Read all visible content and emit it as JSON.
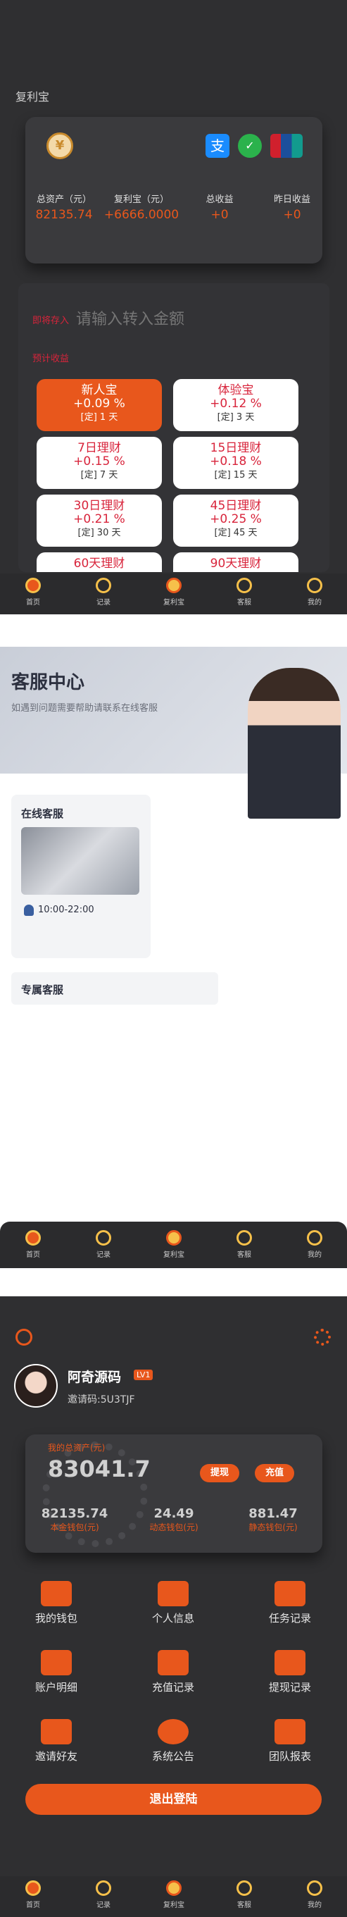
{
  "colors": {
    "accent": "#e8571c",
    "dark_bg": "#2f2f31",
    "card_bg": "#3a3a3d",
    "red_text": "#d8243b"
  },
  "wealth": {
    "page_title": "复利宝",
    "stats": [
      {
        "label": "总资产（元）",
        "value": "82135.74"
      },
      {
        "label": "复利宝（元）",
        "value": "+6666.0000"
      },
      {
        "label": "总收益",
        "value": "+0"
      },
      {
        "label": "昨日收益",
        "value": "+0"
      }
    ],
    "deposit_label": "即将存入",
    "amount_placeholder": "请输入转入金额",
    "expected_label": "预计收益",
    "products": [
      {
        "name": "新人宝",
        "rate": "+0.09 %",
        "days": "[定] 1 天",
        "active": true
      },
      {
        "name": "体验宝",
        "rate": "+0.12 %",
        "days": "[定] 3 天",
        "active": false
      },
      {
        "name": "7日理财",
        "rate": "+0.15 %",
        "days": "[定] 7 天",
        "active": false
      },
      {
        "name": "15日理财",
        "rate": "+0.18 %",
        "days": "[定] 15 天",
        "active": false
      },
      {
        "name": "30日理财",
        "rate": "+0.21 %",
        "days": "[定] 30 天",
        "active": false
      },
      {
        "name": "45日理财",
        "rate": "+0.25 %",
        "days": "[定] 45 天",
        "active": false
      },
      {
        "name": "60天理财",
        "rate": "",
        "days": "",
        "active": false
      },
      {
        "name": "90天理财",
        "rate": "",
        "days": "",
        "active": false
      }
    ]
  },
  "service": {
    "title": "客服中心",
    "subtitle": "如遇到问题需要帮助请联系在线客服",
    "online_label": "在线客服",
    "hours": "10:00-22:00",
    "exclusive_label": "专属客服"
  },
  "profile": {
    "username": "阿奇源码",
    "level": "LV1",
    "invite_code": "邀请码:5U3TJF",
    "total_assets_label": "我的总资产(元)",
    "total_assets": "83041.7",
    "withdraw_label": "提现",
    "recharge_label": "充值",
    "wallets": [
      {
        "value": "82135.74",
        "label": "本金钱包(元)"
      },
      {
        "value": "24.49",
        "label": "动态钱包(元)"
      },
      {
        "value": "881.47",
        "label": "静态钱包(元)"
      }
    ],
    "menu": [
      {
        "label": "我的钱包",
        "icon": "wallet-icon"
      },
      {
        "label": "个人信息",
        "icon": "id-card-icon"
      },
      {
        "label": "任务记录",
        "icon": "task-doc-icon"
      },
      {
        "label": "账户明细",
        "icon": "account-detail-icon"
      },
      {
        "label": "充值记录",
        "icon": "card-icon"
      },
      {
        "label": "提现记录",
        "icon": "withdraw-wallet-icon"
      },
      {
        "label": "邀请好友",
        "icon": "gift-icon"
      },
      {
        "label": "系统公告",
        "icon": "chat-icon"
      },
      {
        "label": "团队报表",
        "icon": "grid-icon"
      }
    ],
    "logout_label": "退出登陆"
  },
  "nav": [
    {
      "label": "首页",
      "icon": "home-icon"
    },
    {
      "label": "记录",
      "icon": "record-icon"
    },
    {
      "label": "复利宝",
      "icon": "money-bag-icon"
    },
    {
      "label": "客服",
      "icon": "service-icon"
    },
    {
      "label": "我的",
      "icon": "profile-icon"
    }
  ]
}
